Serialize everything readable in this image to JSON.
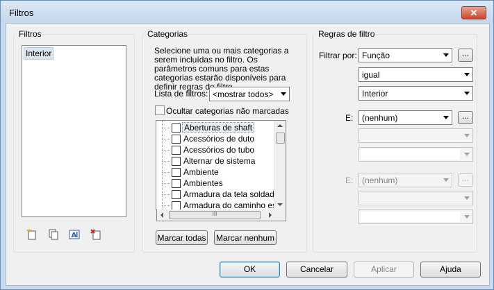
{
  "window": {
    "title": "Filtros",
    "close_label": "✕"
  },
  "filters_group": {
    "legend": "Filtros",
    "items": [
      "Interior"
    ],
    "icons": [
      "new-filter-icon",
      "duplicate-filter-icon",
      "rename-filter-icon",
      "delete-filter-icon"
    ]
  },
  "categories_group": {
    "legend": "Categorias",
    "description": "Selecione uma ou mais categorias a serem incluídas no filtro. Os parâmetros comuns para estas categorias estarão disponíveis para definir regras de filtro.",
    "filter_list_label": "Lista de filtros:",
    "filter_list_value": "<mostrar todos>",
    "hide_unchecked_label": "Ocultar categorias não marcadas",
    "hide_unchecked_checked": false,
    "items": [
      "Aberturas de shaft",
      "Acessórios de duto",
      "Acessórios do tubo",
      "Alternar de sistema",
      "Ambiente",
      "Ambientes",
      "Armadura da tela soldada estru",
      "Armadura do caminho estrut..."
    ],
    "hscroll_grip": "III",
    "check_all_label": "Marcar todas",
    "check_none_label": "Marcar nenhum"
  },
  "rules_group": {
    "legend": "Regras de filtro",
    "filter_by_label": "Filtrar por:",
    "rule1": {
      "parameter": "Função",
      "operator": "igual",
      "value": "Interior"
    },
    "and1_label": "E:",
    "rule2": {
      "parameter": "(nenhum)",
      "operator": "",
      "value": ""
    },
    "and2_label": "E:",
    "rule3": {
      "parameter": "(nenhum)",
      "operator": "",
      "value": ""
    },
    "dots_label": "..."
  },
  "footer": {
    "ok_label": "OK",
    "cancel_label": "Cancelar",
    "apply_label": "Aplicar",
    "help_label": "Ajuda"
  }
}
